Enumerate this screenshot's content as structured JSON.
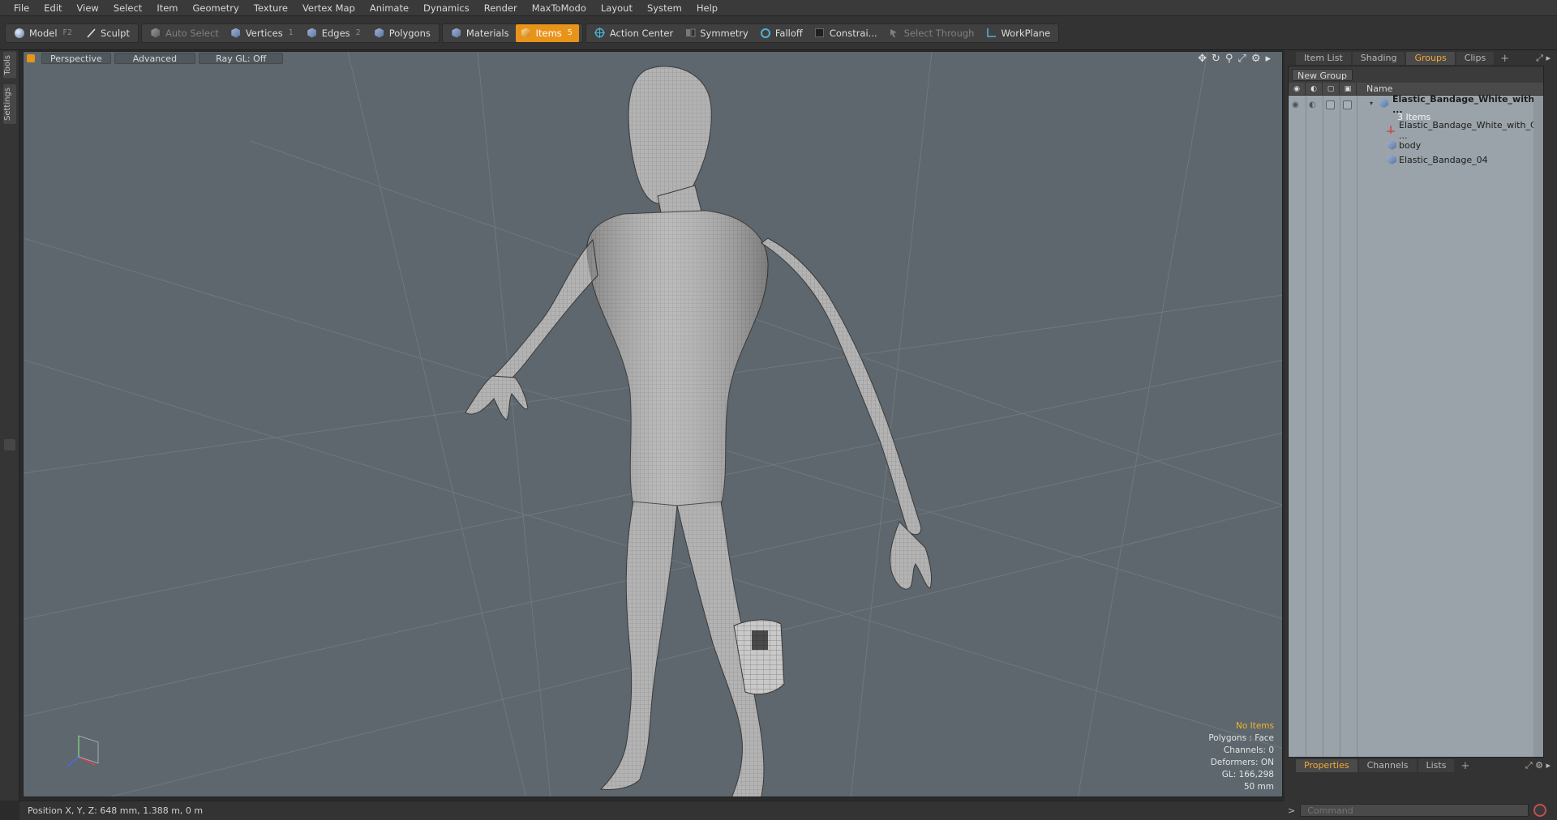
{
  "menu": [
    "File",
    "Edit",
    "View",
    "Select",
    "Item",
    "Geometry",
    "Texture",
    "Vertex Map",
    "Animate",
    "Dynamics",
    "Render",
    "MaxToModo",
    "Layout",
    "System",
    "Help"
  ],
  "toolbar": {
    "model": "Model",
    "model_key": "F2",
    "sculpt": "Sculpt",
    "auto_select": "Auto Select",
    "vertices": "Vertices",
    "vertices_key": "1",
    "edges": "Edges",
    "edges_key": "2",
    "polygons": "Polygons",
    "materials": "Materials",
    "items": "Items",
    "items_key": "5",
    "action_center": "Action Center",
    "symmetry": "Symmetry",
    "falloff": "Falloff",
    "constraints": "Constrai...",
    "select_through": "Select Through",
    "workplane": "WorkPlane",
    "accent_color": "#e8941a"
  },
  "left_tabs": {
    "tools": "Tools",
    "settings": "Settings"
  },
  "viewport": {
    "view": "Perspective",
    "shading": "Advanced",
    "raygl": "Ray GL: Off",
    "bg_color": "#5d676d",
    "stats": {
      "no_items": "No Items",
      "polygons": "Polygons : Face",
      "channels": "Channels: 0",
      "deformers": "Deformers: ON",
      "gl": "GL: 166,298",
      "scale": "50 mm"
    }
  },
  "statusbar": {
    "position": "Position X, Y, Z:   648 mm, 1.388 m, 0 m"
  },
  "right_panel": {
    "tabs": [
      "Item List",
      "Shading",
      "Groups",
      "Clips"
    ],
    "active_tab": "Groups",
    "new_group": "New Group",
    "column_name": "Name",
    "group_name": "Elastic_Bandage_White_with_ ...",
    "group_count": "3 Items",
    "children": [
      "Elastic_Bandage_White_with_Cla ...",
      "body",
      "Elastic_Bandage_04"
    ],
    "bottom_tabs": [
      "Properties",
      "Channels",
      "Lists"
    ],
    "bottom_active": "Properties",
    "command_placeholder": "Command"
  }
}
